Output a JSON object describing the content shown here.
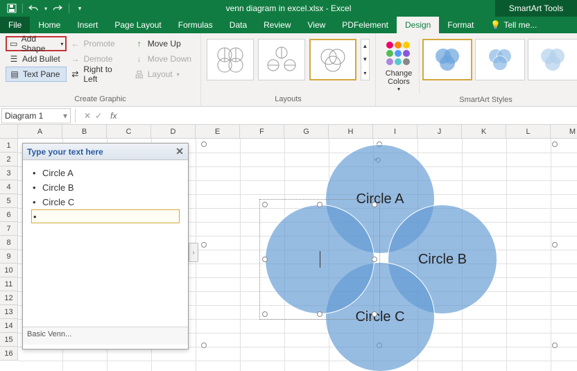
{
  "titlebar": {
    "title": "venn diagram in excel.xlsx - Excel",
    "tools": "SmartArt Tools"
  },
  "tabs": {
    "file": "File",
    "home": "Home",
    "insert": "Insert",
    "page_layout": "Page Layout",
    "formulas": "Formulas",
    "data": "Data",
    "review": "Review",
    "view": "View",
    "pdfelement": "PDFelement",
    "design": "Design",
    "format": "Format",
    "tellme": "Tell me..."
  },
  "ribbon": {
    "create_graphic": {
      "add_shape": "Add Shape",
      "add_bullet": "Add Bullet",
      "text_pane": "Text Pane",
      "promote": "Promote",
      "demote": "Demote",
      "right_to_left": "Right to Left",
      "move_up": "Move Up",
      "move_down": "Move Down",
      "layout": "Layout",
      "group_label": "Create Graphic"
    },
    "layouts": {
      "group_label": "Layouts"
    },
    "change_colors": "Change Colors",
    "styles": {
      "group_label": "SmartArt Styles"
    }
  },
  "namebox": "Diagram 1",
  "fx_label": "fx",
  "columns": [
    "A",
    "B",
    "C",
    "D",
    "E",
    "F",
    "G",
    "H",
    "I",
    "J",
    "K",
    "L",
    "M"
  ],
  "rows": [
    "1",
    "2",
    "3",
    "4",
    "5",
    "6",
    "7",
    "8",
    "9",
    "10",
    "11",
    "12",
    "13",
    "14",
    "15",
    "16"
  ],
  "textpane": {
    "title": "Type your text here",
    "items": [
      "Circle A",
      "Circle B",
      "Circle C"
    ],
    "footer": "Basic Venn..."
  },
  "venn": {
    "a": "Circle A",
    "b": "Circle B",
    "c": "Circle C"
  }
}
